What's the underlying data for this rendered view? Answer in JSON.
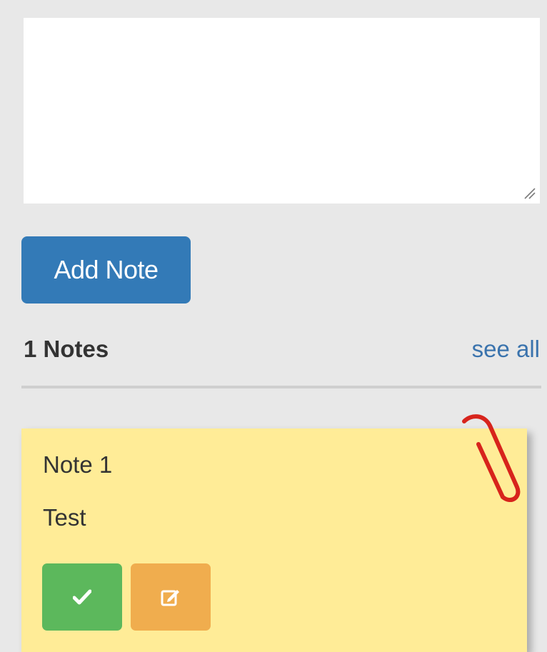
{
  "note_input": {
    "value": ""
  },
  "actions": {
    "add_note_label": "Add Note"
  },
  "notes_header": {
    "count_label": "1 Notes",
    "see_all_label": "see all"
  },
  "notes": [
    {
      "title": "Note 1",
      "body": "Test"
    }
  ],
  "icons": {
    "complete": "check-icon",
    "edit": "edit-icon",
    "decoration": "paperclip-icon",
    "resize": "resize-handle-icon"
  },
  "colors": {
    "primary": "#337ab7",
    "success": "#5cb85c",
    "warning": "#f0ad4e",
    "note_background": "#ffec97",
    "link": "#3a73ad",
    "paperclip": "#d7241c"
  }
}
